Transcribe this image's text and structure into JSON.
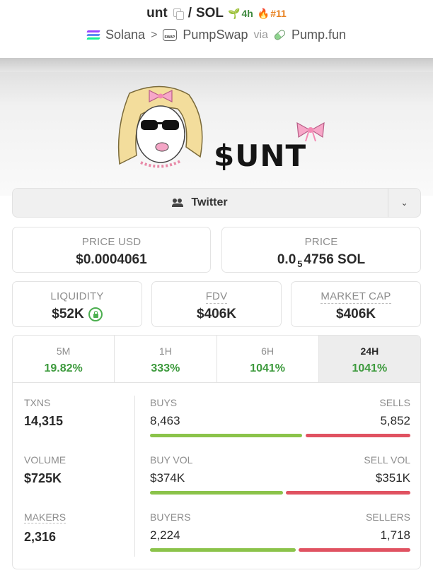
{
  "header": {
    "token": "unt",
    "separator": "/",
    "quote": "SOL",
    "age": "4h",
    "rank": "#11",
    "chain": "Solana",
    "dex": "PumpSwap",
    "via_label": "via",
    "launchpad": "Pump.fun"
  },
  "banner": {
    "ticker_art": "$UNT"
  },
  "social": {
    "label": "Twitter"
  },
  "prices": {
    "price_usd_label": "PRICE USD",
    "price_usd": "$0.0004061",
    "price_label": "PRICE",
    "price_prefix": "0.0",
    "price_zeros": "5",
    "price_suffix": "4756 SOL"
  },
  "metrics": {
    "liquidity_label": "LIQUIDITY",
    "liquidity": "$52K",
    "fdv_label": "FDV",
    "fdv": "$406K",
    "mcap_label": "MARKET CAP",
    "mcap": "$406K"
  },
  "timeframes": [
    {
      "label": "5M",
      "change": "19.82%"
    },
    {
      "label": "1H",
      "change": "333%"
    },
    {
      "label": "6H",
      "change": "1041%"
    },
    {
      "label": "24H",
      "change": "1041%"
    }
  ],
  "stats": {
    "txns_label": "TXNS",
    "txns": "14,315",
    "buys_label": "BUYS",
    "buys": "8,463",
    "sells_label": "SELLS",
    "sells": "5,852",
    "buys_ratio": 0.591,
    "volume_label": "VOLUME",
    "volume": "$725K",
    "buy_vol_label": "BUY VOL",
    "buy_vol": "$374K",
    "sell_vol_label": "SELL VOL",
    "sell_vol": "$351K",
    "buy_vol_ratio": 0.516,
    "makers_label": "MAKERS",
    "makers": "2,316",
    "buyers_label": "BUYERS",
    "buyers": "2,224",
    "sellers_label": "SELLERS",
    "sellers": "1,718",
    "buyers_ratio": 0.564
  },
  "colors": {
    "positive": "#3d9a3d",
    "buy_bar": "#8bc34a",
    "sell_bar": "#e05261",
    "rank": "#e8811f"
  },
  "icons": {
    "copy": "copy-icon",
    "age": "seedling-icon",
    "rank": "flame-icon",
    "chain": "solana-logo-icon",
    "social": "users-icon",
    "liquidity": "lock-icon",
    "dropdown": "chevron-down-icon"
  }
}
